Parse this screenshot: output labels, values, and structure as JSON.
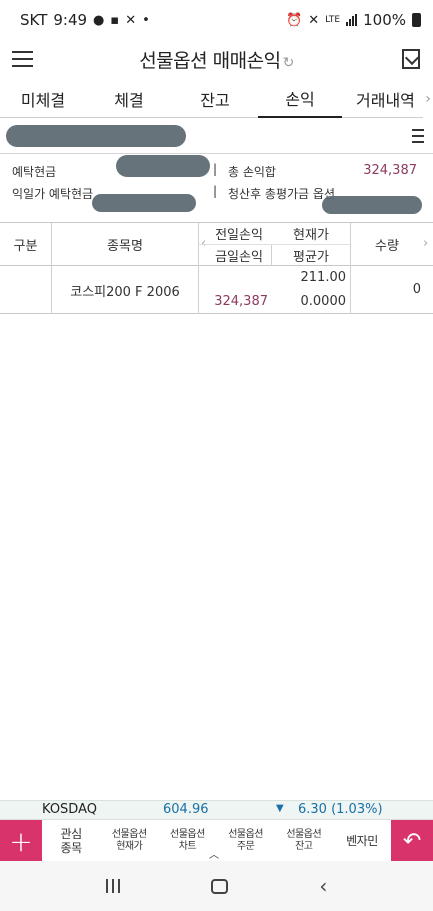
{
  "status": {
    "carrier": "SKT",
    "time": "9:49",
    "battery": "100%",
    "network": "LTE"
  },
  "header": {
    "title": "선물옵션 매매손익",
    "refresh_glyph": "↻"
  },
  "tabs": [
    {
      "label": "미체결",
      "active": false
    },
    {
      "label": "체결",
      "active": false
    },
    {
      "label": "잔고",
      "active": false
    },
    {
      "label": "손익",
      "active": true
    },
    {
      "label": "거래내역",
      "active": false
    }
  ],
  "info": {
    "deposit_cash_label": "예탁현금",
    "total_pnl_label": "총 손익합",
    "total_pnl_value": "324,387",
    "next_day_cash_label": "익일가 예탁현금",
    "post_settlement_label": "청산후 총평가금 옵션"
  },
  "table": {
    "headers": {
      "type": "구분",
      "name": "종목명",
      "prev_pnl": "전일손익",
      "current_price": "현재가",
      "today_pnl": "금일손익",
      "avg_price": "평균가",
      "quantity": "수량"
    },
    "rows": [
      {
        "type": "",
        "name": "코스피200 F 2006",
        "prev_pnl": "",
        "today_pnl": "324,387",
        "current_price": "211.00",
        "avg_price": "0.0000",
        "quantity": "0"
      }
    ]
  },
  "ticker": {
    "name": "KOSDAQ",
    "price": "604.96",
    "direction": "down",
    "change": "6.30 (1.03%)"
  },
  "toolbar": {
    "items": [
      {
        "line1": "관심",
        "line2": "종목",
        "big": true
      },
      {
        "line1": "선물옵션",
        "line2": "현재가",
        "big": false
      },
      {
        "line1": "선물옵션",
        "line2": "차트",
        "big": false
      },
      {
        "line1": "선물옵션",
        "line2": "주문",
        "big": false
      },
      {
        "line1": "선물옵션",
        "line2": "잔고",
        "big": false
      },
      {
        "line1": "벤자민",
        "line2": "",
        "big": true
      }
    ]
  },
  "colors": {
    "accent": "#d8336b",
    "profit": "#8c3a5f",
    "ticker_down": "#1a6fa5"
  }
}
